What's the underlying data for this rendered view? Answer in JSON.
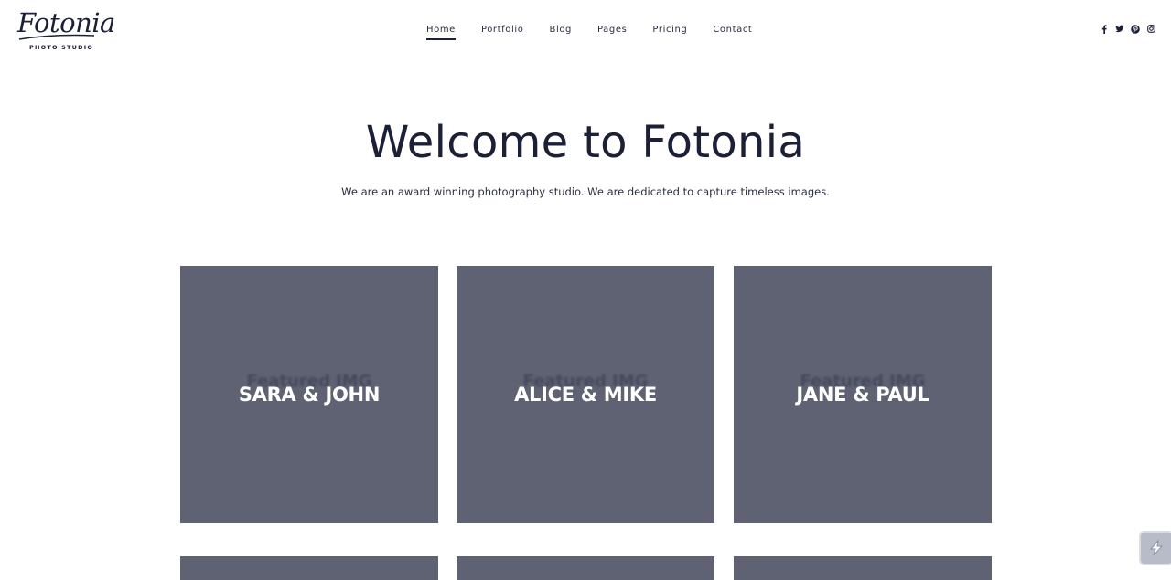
{
  "brand": {
    "name": "Fotonia",
    "tagline": "PHOTO STUDIO"
  },
  "nav": {
    "items": [
      {
        "label": "Home",
        "active": true
      },
      {
        "label": "Portfolio",
        "active": false
      },
      {
        "label": "Blog",
        "active": false
      },
      {
        "label": "Pages",
        "active": false
      },
      {
        "label": "Pricing",
        "active": false
      },
      {
        "label": "Contact",
        "active": false
      }
    ]
  },
  "social": [
    "facebook-icon",
    "twitter-icon",
    "pinterest-icon",
    "instagram-icon"
  ],
  "hero": {
    "title": "Welcome to Fotonia",
    "subtitle": "We are an award winning photography studio. We are dedicated to capture timeless images."
  },
  "gallery": {
    "placeholder": "Featured IMG",
    "items": [
      {
        "title": "SARA & JOHN"
      },
      {
        "title": "ALICE & MIKE"
      },
      {
        "title": "JANE & PAUL"
      }
    ]
  },
  "colors": {
    "primary": "#1c2036",
    "card": "#5e6273",
    "background": "#ffffff"
  }
}
